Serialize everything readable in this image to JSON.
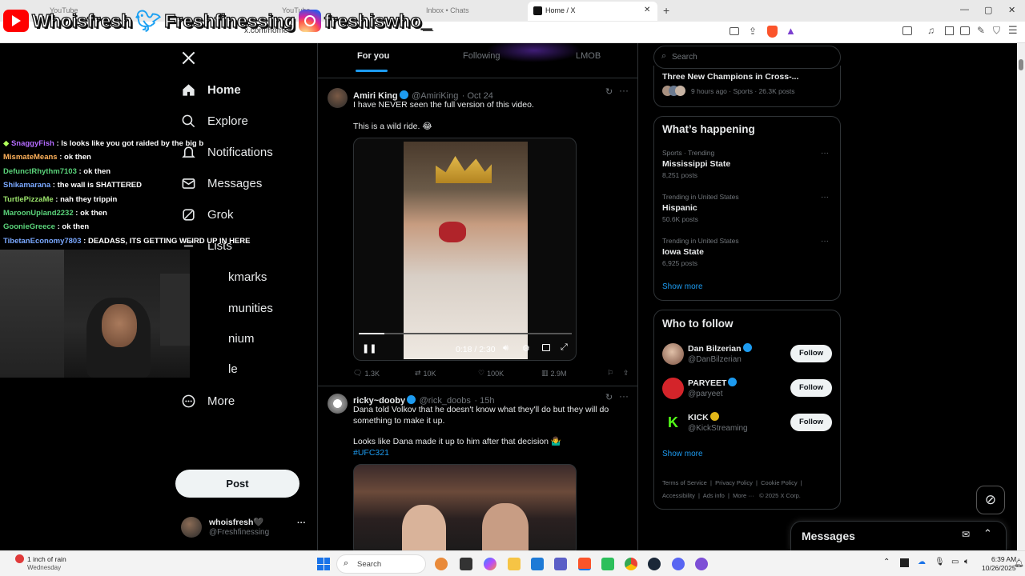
{
  "browser": {
    "tabs": [
      {
        "label": "YouTube"
      },
      {
        "label": "YouTube"
      },
      {
        "label": "Inbox • Chats"
      },
      {
        "label": "Home / X",
        "active": true
      }
    ],
    "address": "x.com/home",
    "add_tab": "+",
    "minimize": "—",
    "maximize": "▢",
    "close": "✕"
  },
  "stream_overlay": {
    "youtube_handle": "Whoisfresh",
    "twitter_handle": "Freshfinessing",
    "instagram_handle": "freshiswho_"
  },
  "chat": [
    {
      "user": "SnaggyFish",
      "text": ": ls looks like you got raided by the big b",
      "color": "#b46bff"
    },
    {
      "user": "MismateMeans",
      "text": ": ok then",
      "color": "#ffb25b"
    },
    {
      "user": "DefunctRhythm7103",
      "text": ": ok then",
      "color": "#5ad37a"
    },
    {
      "user": "Shikamarana",
      "text": ": the wall is SHATTERED",
      "color": "#7aa8ff"
    },
    {
      "user": "TurtlePizzaMe",
      "text": ": nah they trippin",
      "color": "#9be36b"
    },
    {
      "user": "MaroonUpland2232",
      "text": ": ok then",
      "color": "#5ad37a"
    },
    {
      "user": "GoonieGreece",
      "text": ": ok then",
      "color": "#5ad37a"
    },
    {
      "user": "TibetanEconomy7803",
      "text": ": DEADASS, ITS GETTING WEIRD UP IN HERE",
      "color": "#7aa8ff"
    }
  ],
  "nav": {
    "items": [
      {
        "label": "Home",
        "icon": "home-icon"
      },
      {
        "label": "Explore",
        "icon": "search-icon"
      },
      {
        "label": "Notifications",
        "icon": "bell-icon"
      },
      {
        "label": "Messages",
        "icon": "mail-icon"
      },
      {
        "label": "Grok",
        "icon": "grok-icon"
      },
      {
        "label": "Lists",
        "icon": "list-icon"
      },
      {
        "label": "kmarks",
        "icon": "bookmark-icon"
      },
      {
        "label": "munities",
        "icon": "communities-icon"
      },
      {
        "label": "nium",
        "icon": "premium-icon"
      },
      {
        "label": "le",
        "icon": "profile-icon"
      },
      {
        "label": "More",
        "icon": "more-icon"
      }
    ],
    "post_button": "Post",
    "profile_name": "whoisfresh🖤",
    "profile_handle": "@Freshfinessing",
    "profile_more": "···"
  },
  "feed": {
    "tabs": [
      "For you",
      "Following",
      "LMOB"
    ],
    "posts": [
      {
        "name": "Amiri King",
        "handle": "@AmiriKing",
        "time": "· Oct 24",
        "text1": "I have NEVER seen the full version of this video.",
        "text2": "This is a wild ride. 😂",
        "video_time": "0:18 / 2:30",
        "video_progress": 0.12,
        "replies": "1.3K",
        "reposts": "10K",
        "likes": "100K",
        "views": "2.9M"
      },
      {
        "name": "ricky~dooby",
        "handle": "@rick_doobs",
        "time": "· 15h",
        "text1": "Dana told Volkov that he doesn't know what they'll do but they will do something to make it up.",
        "text2": "Looks like Dana made it up to him after that decision 🤷‍♂️",
        "hashtag": "#UFC321"
      }
    ]
  },
  "right": {
    "search_placeholder": "Search",
    "top_story": {
      "title": "Three New Champions in Cross-...",
      "meta": "9 hours ago · Sports · 26.3K posts"
    },
    "happening_title": "What’s happening",
    "trends": [
      {
        "meta": "Sports · Trending",
        "name": "Mississippi State",
        "posts": "8,251 posts"
      },
      {
        "meta": "Trending in United States",
        "name": "Hispanic",
        "posts": "50.6K posts"
      },
      {
        "meta": "Trending in United States",
        "name": "Iowa State",
        "posts": "6,925 posts"
      }
    ],
    "show_more": "Show more",
    "who_title": "Who to follow",
    "follow_label": "Follow",
    "who": [
      {
        "name": "Dan Bilzerian",
        "handle": "@DanBilzerian"
      },
      {
        "name": "PARYEET",
        "handle": "@paryeet"
      },
      {
        "name": "KICK",
        "handle": "@KickStreaming"
      }
    ],
    "footer_row1": [
      "Terms of Service",
      "Privacy Policy",
      "Cookie Policy"
    ],
    "footer_row2": [
      "Accessibility",
      "Ads info",
      "More ···",
      "© 2025 X Corp."
    ],
    "messages_title": "Messages"
  },
  "taskbar": {
    "weather_title": "1 inch of rain",
    "weather_sub": "Wednesday",
    "search": "Search",
    "time": "6:39 AM",
    "date": "10/26/2025"
  }
}
